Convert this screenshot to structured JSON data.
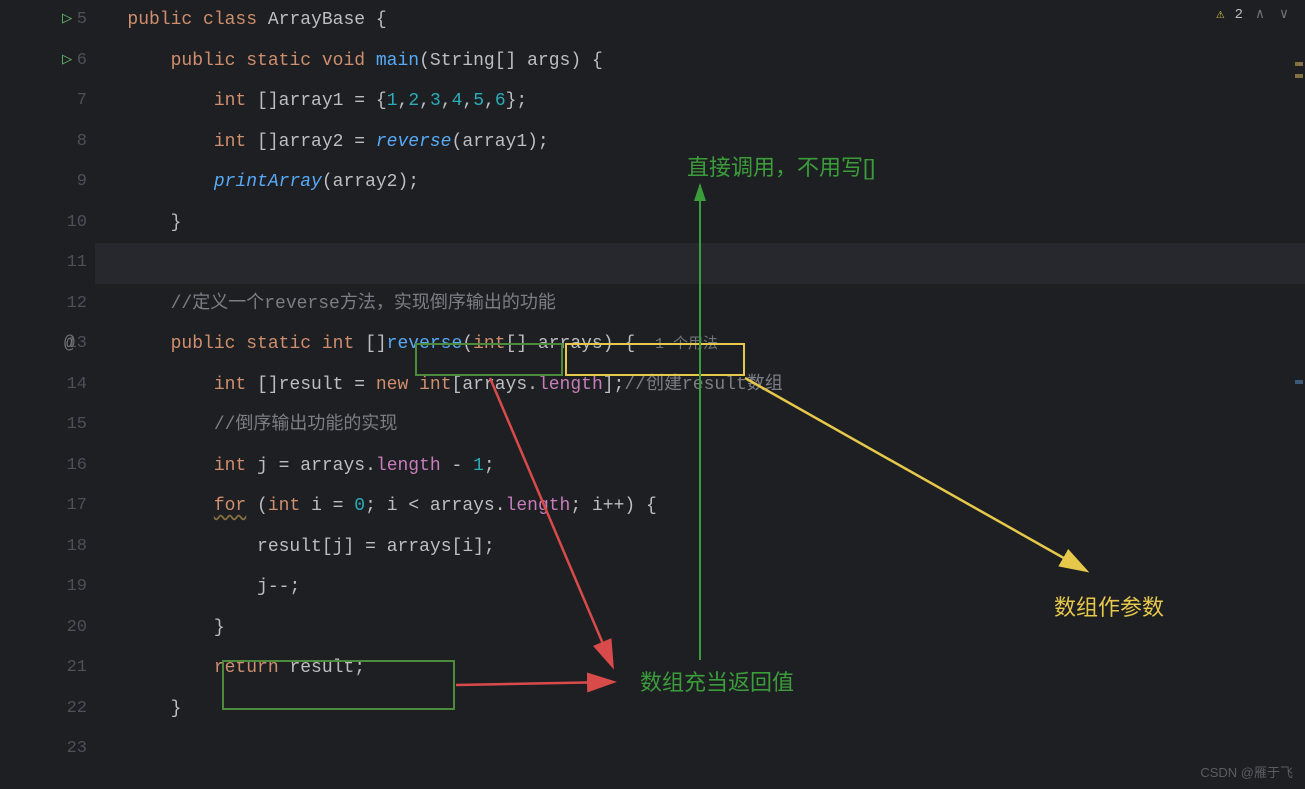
{
  "gutter": {
    "lines": [
      "5",
      "6",
      "7",
      "8",
      "9",
      "10",
      "11",
      "12",
      "13",
      "14",
      "15",
      "16",
      "17",
      "18",
      "19",
      "20",
      "21",
      "22",
      "23"
    ],
    "runIcons": [
      0,
      1
    ],
    "atIcons": [
      8
    ]
  },
  "code": {
    "l5": {
      "t1": "public class ",
      "t2": "ArrayBase ",
      "t3": "{"
    },
    "l6": {
      "t1": "public static ",
      "t2": "void ",
      "t3": "main",
      "t4": "(",
      "t5": "String",
      "t6": "[] ",
      "t7": "args",
      "t8": ") {"
    },
    "l7": {
      "t1": "int ",
      "t2": "[]",
      "t3": "array1",
      "t4": " = {",
      "n1": "1",
      "c": ",",
      "n2": "2",
      "n3": "3",
      "n4": "4",
      "n5": "5",
      "n6": "6",
      "t5": "};"
    },
    "l8": {
      "t1": "int ",
      "t2": "[]",
      "t3": "array2",
      "t4": " = ",
      "m": "reverse",
      "t5": "(",
      "a": "array1",
      "t6": ");"
    },
    "l9": {
      "m": "printArray",
      "t1": "(",
      "a": "array2",
      "t2": ");"
    },
    "l10": {
      "t": "}"
    },
    "l11": {
      "t": ""
    },
    "l12": {
      "c": "//定义一个reverse方法，实现倒序输出的功能"
    },
    "l13": {
      "t1": "public static ",
      "t2": "int",
      "t3": " []",
      "m": "reverse",
      "t4": "(",
      "t5": "int",
      "t6": "[] ",
      "a": "arrays",
      "t7": ") { ",
      "hint": " 1 个用法"
    },
    "l14": {
      "t1": "int ",
      "t2": "[]",
      "v": "result",
      "t3": " = ",
      "kw": "new ",
      "t4": "int",
      "t5": "[",
      "a": "arrays",
      "t6": ".",
      "f": "length",
      "t7": "];",
      "c": "//创建result数组"
    },
    "l15": {
      "c": "//倒序输出功能的实现"
    },
    "l16": {
      "t1": "int ",
      "v": "j",
      "t2": " = ",
      "a": "arrays",
      "t3": ".",
      "f": "length",
      "t4": " - ",
      "n": "1",
      "t5": ";"
    },
    "l17": {
      "kw": "for",
      "t1": " (",
      "t2": "int ",
      "v": "i",
      "t3": " = ",
      "n1": "0",
      "t4": "; ",
      "v2": "i",
      "t5": " < ",
      "a": "arrays",
      "t6": ".",
      "f": "length",
      "t7": "; ",
      "v3": "i",
      "t8": "++) {"
    },
    "l18": {
      "v": "result",
      "t1": "[",
      "v2": "j",
      "t2": "] = ",
      "a": "arrays",
      "t3": "[",
      "v3": "i",
      "t4": "];"
    },
    "l19": {
      "v": "j",
      "t": "--;"
    },
    "l20": {
      "t": "}"
    },
    "l21": {
      "kw": "return ",
      "v": "result",
      "t": ";"
    },
    "l22": {
      "t": "}"
    },
    "l23": {
      "t": ""
    }
  },
  "annotations": {
    "label_call_direct": "直接调用，不用写[]",
    "label_return": "数组充当返回值",
    "label_param": "数组作参数"
  },
  "topRight": {
    "warnCount": "2"
  },
  "watermark": "CSDN @雁于飞"
}
